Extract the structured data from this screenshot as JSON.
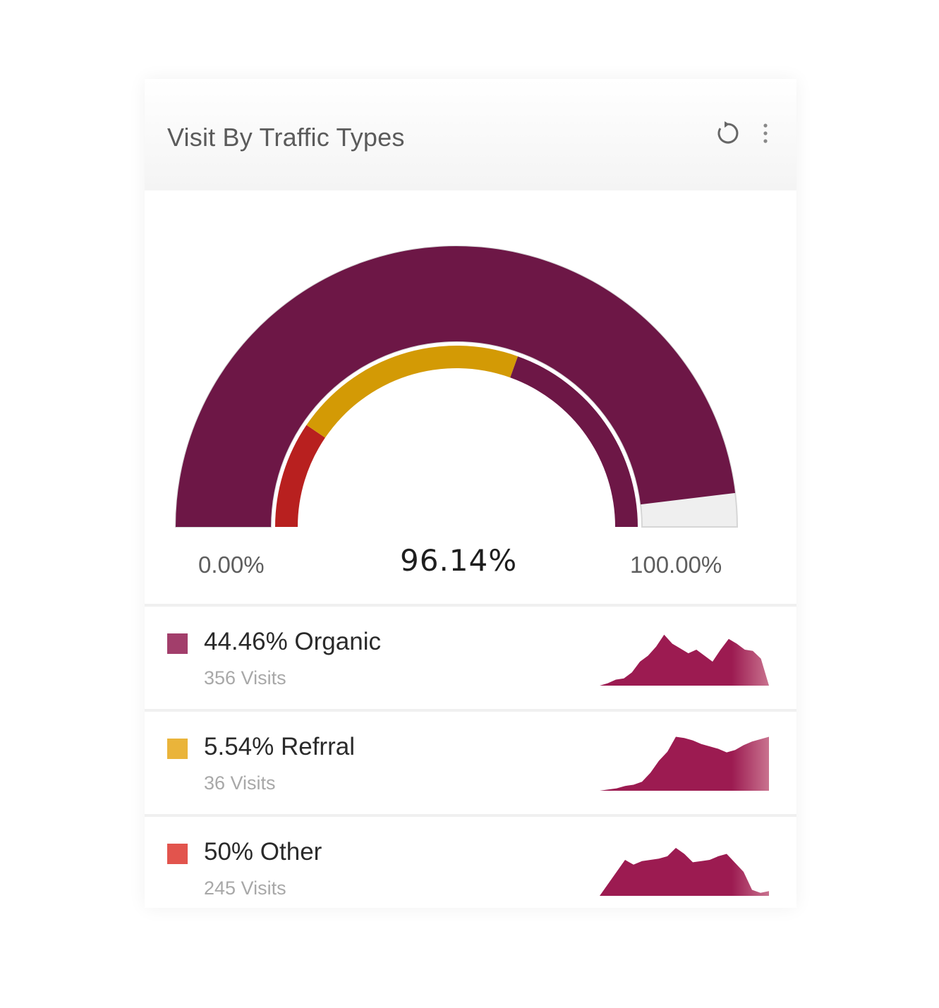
{
  "card": {
    "title": "Visit By Traffic Types",
    "actions": {
      "refresh_icon": "refresh-icon",
      "more_icon": "more-vertical-icon"
    }
  },
  "gauge": {
    "min_label": "0.00%",
    "max_label": "100.00%",
    "value_label": "96.14%",
    "outer_fill_fraction": 0.9614,
    "inner_segments": [
      {
        "name": "Other",
        "fraction": 0.19,
        "color": "#b8201f"
      },
      {
        "name": "Refrral",
        "fraction": 0.42,
        "color": "#d39a05"
      },
      {
        "name": "Organic",
        "fraction": 0.39,
        "color": "#6d1746"
      }
    ],
    "colors": {
      "outer": "#6d1746",
      "track": "#efefef"
    }
  },
  "legend": [
    {
      "label": "44.46% Organic",
      "sub": "356 Visits",
      "color": "#a23e6b",
      "spark": [
        0,
        4,
        10,
        12,
        22,
        40,
        50,
        65,
        85,
        70,
        62,
        54,
        60,
        50,
        40,
        60,
        78,
        70,
        60,
        58,
        45,
        0
      ]
    },
    {
      "label": "5.54% Refrral",
      "sub": "36 Visits",
      "color": "#eab43a",
      "spark": [
        0,
        2,
        4,
        8,
        10,
        15,
        30,
        50,
        65,
        90,
        88,
        84,
        78,
        74,
        70,
        64,
        68,
        76,
        82,
        86,
        90
      ]
    },
    {
      "label": "50% Other",
      "sub": "245 Visits",
      "color": "#e2544d",
      "spark": [
        0,
        20,
        40,
        60,
        52,
        58,
        60,
        62,
        66,
        80,
        70,
        56,
        58,
        60,
        66,
        70,
        55,
        40,
        10,
        5,
        8
      ]
    }
  ]
}
